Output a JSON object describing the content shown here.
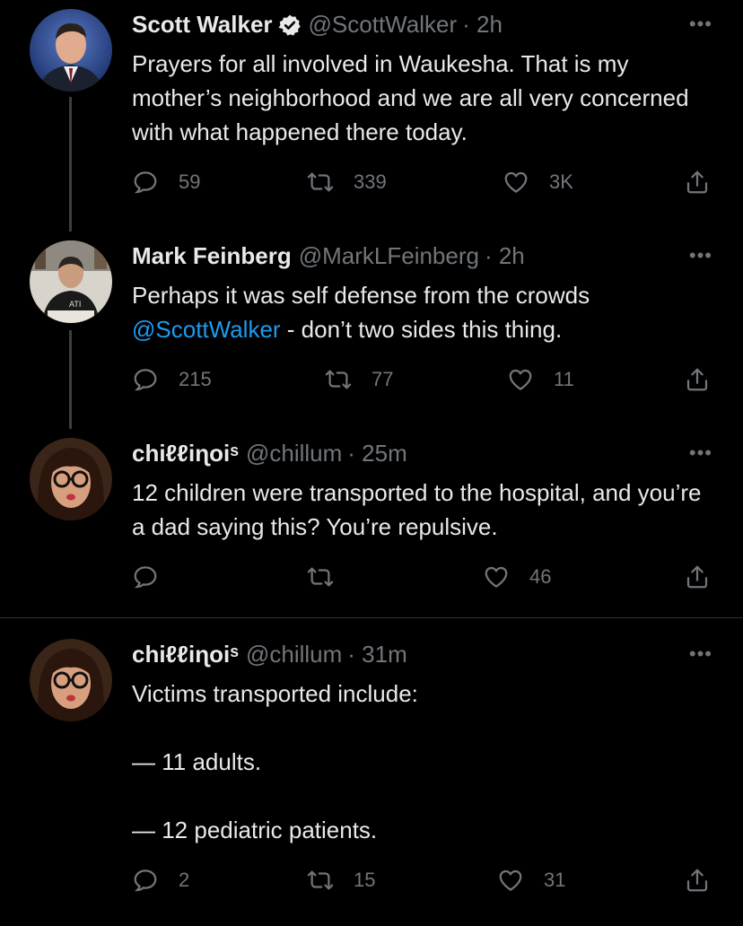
{
  "tweets": [
    {
      "name": "Scott Walker",
      "verified": true,
      "handle": "@ScottWalker",
      "time": "· 2h",
      "more": "•••",
      "text": "Prayers for all involved in Waukesha. That is my mother’s neighborhood and we are all very concerned with what happened there today.",
      "replies": "59",
      "retweets": "339",
      "likes": "3K"
    },
    {
      "name": "Mark Feinberg",
      "handle": "@MarkLFeinberg",
      "time": "· 2h",
      "more": "•••",
      "text_before": "Perhaps it was self defense from the crowds ",
      "mention": "@ScottWalker",
      "text_after": " - don’t two sides this thing.",
      "replies": "215",
      "retweets": "77",
      "likes": "11"
    },
    {
      "name": "chiℓℓiɳoiˢ",
      "handle": "@chillum",
      "time": "· 25m",
      "more": "•••",
      "text": "12 children were transported to the hospital, and you’re a dad saying this? You’re repulsive.",
      "replies": "",
      "retweets": "",
      "likes": "46"
    },
    {
      "name": "chiℓℓiɳoiˢ",
      "handle": "@chillum",
      "time": "· 31m",
      "more": "•••",
      "text": "Victims transported include:\n\n— 11 adults.\n\n— 12 pediatric patients.",
      "replies": "2",
      "retweets": "15",
      "likes": "31"
    }
  ],
  "colors": {
    "accent": "#1d9bf0",
    "muted": "#71767b",
    "text": "#e7e9ea",
    "background": "#000000"
  },
  "icons": [
    "reply-icon",
    "retweet-icon",
    "like-icon",
    "share-icon",
    "verified-badge-icon",
    "more-icon"
  ]
}
